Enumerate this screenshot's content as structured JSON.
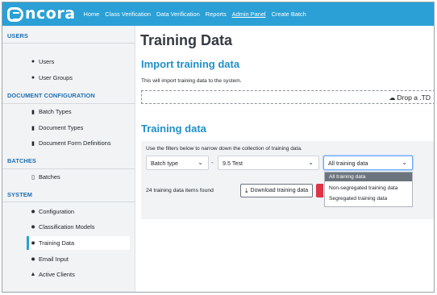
{
  "app": {
    "brand": "ncora"
  },
  "nav": {
    "items": [
      "Home",
      "Class Verification",
      "Data Verification",
      "Reports",
      "Admin Panel",
      "Create Batch"
    ],
    "active": "Admin Panel"
  },
  "sidebar": {
    "sections": [
      {
        "header": "USERS",
        "items": [
          {
            "label": "Users",
            "icon": "user-icon"
          },
          {
            "label": "User Groups",
            "icon": "users-icon"
          }
        ]
      },
      {
        "header": "DOCUMENT CONFIGURATION",
        "items": [
          {
            "label": "Batch Types",
            "icon": "file-icon"
          },
          {
            "label": "Document Types",
            "icon": "file-icon"
          },
          {
            "label": "Document Form Definitions",
            "icon": "file-icon"
          }
        ]
      },
      {
        "header": "BATCHES",
        "items": [
          {
            "label": "Batches",
            "icon": "file-outline-icon"
          }
        ]
      },
      {
        "header": "SYSTEM",
        "items": [
          {
            "label": "Configuration",
            "icon": "gear-icon"
          },
          {
            "label": "Classification Models",
            "icon": "gear-icon"
          },
          {
            "label": "Training Data",
            "icon": "gear-icon",
            "active": true
          },
          {
            "label": "Email Input",
            "icon": "gear-icon"
          },
          {
            "label": "Active Clients",
            "icon": "person-icon"
          }
        ]
      }
    ]
  },
  "main": {
    "title": "Training Data",
    "import": {
      "title": "Import training data",
      "description": "This will import training data to the system.",
      "drop_text": "Drop a .TD"
    },
    "training": {
      "title": "Training data",
      "filter_hint": "Use the filters below to narrow down the collection of training data.",
      "batch_type": "Batch type",
      "separator": "-",
      "version": "9.5 Test",
      "data_filter": "All training data",
      "found_text": "24 training data items found",
      "download_label": "Download training data",
      "dropdown_options": [
        "All training data",
        "Non-segregated training data",
        "Segregated training data"
      ],
      "selected_option": "All training data"
    }
  },
  "colors": {
    "navbar": "#2aa0d6",
    "section_header": "#1f6fb2",
    "section_title": "#2090c8",
    "sidebar_bg": "#f1f3f5",
    "danger": "#dc3545"
  }
}
